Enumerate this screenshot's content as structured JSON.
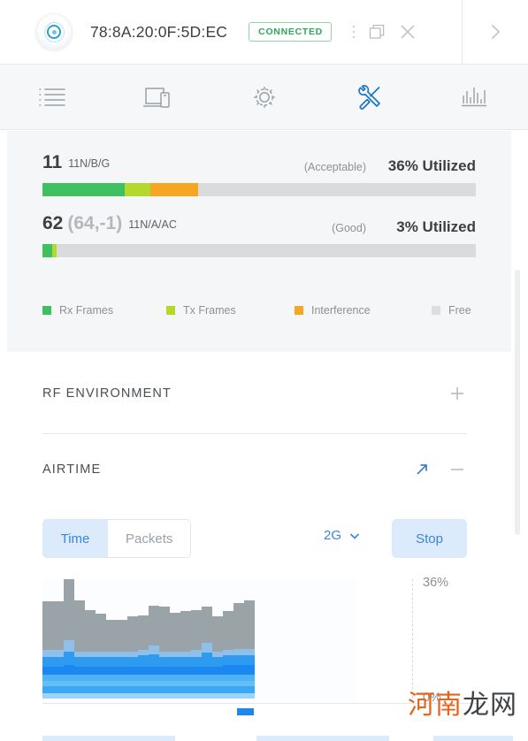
{
  "header": {
    "device_icon": "access-point-icon",
    "mac_address": "78:8A:20:0F:5D:EC",
    "status": "CONNECTED",
    "status_color": "#2fa75a",
    "actions": [
      {
        "name": "more-options",
        "icon": "kebab-menu-icon"
      },
      {
        "name": "restore-window",
        "icon": "restore-window-icon"
      },
      {
        "name": "close-panel",
        "icon": "close-icon"
      }
    ],
    "next_icon": "chevron-right-icon"
  },
  "toolbar": {
    "items": [
      {
        "name": "overview",
        "icon": "list-icon",
        "active": false
      },
      {
        "name": "devices",
        "icon": "device-screen-icon",
        "active": false
      },
      {
        "name": "config",
        "icon": "gear-icon",
        "active": false
      },
      {
        "name": "tools",
        "icon": "tools-icon",
        "active": true
      },
      {
        "name": "statistics",
        "icon": "bar-chart-icon",
        "active": false
      }
    ],
    "accent": "#1b73c8"
  },
  "utilization": {
    "rows": [
      {
        "channel": "11",
        "channel_sub": "",
        "mode": "11N/B/G",
        "quality": "(Acceptable)",
        "utilized": "36% Utilized",
        "segments": [
          {
            "name": "rx",
            "pct": 19.0,
            "color": "#3fc162"
          },
          {
            "name": "tx",
            "pct": 6.0,
            "color": "#b4d92c"
          },
          {
            "name": "interference",
            "pct": 11.0,
            "color": "#f5a623"
          }
        ],
        "free_pct": 64.0
      },
      {
        "channel": "62",
        "channel_sub": "(64,-1)",
        "mode": "11N/A/AC",
        "quality": "(Good)",
        "utilized": "3% Utilized",
        "segments": [
          {
            "name": "rx",
            "pct": 2.2,
            "color": "#3fc162"
          },
          {
            "name": "tx",
            "pct": 1.0,
            "color": "#b4d92c"
          }
        ],
        "free_pct": 96.8
      }
    ],
    "legend": [
      {
        "label": "Rx Frames",
        "color": "#3fc162"
      },
      {
        "label": "Tx Frames",
        "color": "#b4d92c"
      },
      {
        "label": "Interference",
        "color": "#f5a623"
      },
      {
        "label": "Free",
        "color": "#dcdee0"
      }
    ],
    "track_color": "#d9dbdd"
  },
  "rf_environment": {
    "title": "RF ENVIRONMENT",
    "expand_icon": "plus-icon",
    "collapsed": true
  },
  "airtime": {
    "title": "AIRTIME",
    "popout_icon": "arrow-up-right-icon",
    "collapse_icon": "minus-icon",
    "tabs": [
      {
        "label": "Time",
        "active": true
      },
      {
        "label": "Packets",
        "active": false
      }
    ],
    "band": "2G",
    "band_chevron": "chevron-down-icon",
    "action_label": "Stop"
  },
  "chart_data": {
    "type": "bar",
    "title": "Airtime",
    "xlabel": "",
    "ylabel": "",
    "ylim": [
      0,
      36
    ],
    "axis_tick_labels": [
      "36%",
      "0%"
    ],
    "grid": false,
    "legend_position": "below-right",
    "stacked": true,
    "series": [
      {
        "name": "free",
        "color": "#9aa3a8",
        "values": [
          17.5,
          17.5,
          22.0,
          18.5,
          15.0,
          13.5,
          11.5,
          11.5,
          12.5,
          12.5,
          14.5,
          16.0,
          14.0,
          14.5,
          14.5,
          13.0,
          12.5,
          14.0,
          16.5,
          17.5
        ]
      },
      {
        "name": "band-1",
        "color": "#8fc0ea",
        "values": [
          2.5,
          2.5,
          4.0,
          2.0,
          2.0,
          2.0,
          2.0,
          2.0,
          2.0,
          2.0,
          3.0,
          2.0,
          2.0,
          2.0,
          2.5,
          3.5,
          2.0,
          2.0,
          2.5,
          2.5
        ]
      },
      {
        "name": "band-2",
        "color": "#2f9bf0",
        "values": [
          3.5,
          3.5,
          5.0,
          3.5,
          3.5,
          3.5,
          3.5,
          3.5,
          3.5,
          4.0,
          4.5,
          3.5,
          3.5,
          3.5,
          3.5,
          5.0,
          3.5,
          3.5,
          3.5,
          3.5
        ]
      },
      {
        "name": "band-3",
        "color": "#1a88f0",
        "values": [
          3.0,
          3.0,
          3.5,
          3.0,
          3.0,
          3.0,
          3.0,
          3.0,
          3.0,
          3.0,
          3.0,
          3.0,
          3.0,
          3.0,
          3.0,
          3.0,
          3.0,
          3.5,
          3.5,
          3.5
        ]
      },
      {
        "name": "band-4",
        "color": "#4eb3f5",
        "values": [
          2.0,
          2.0,
          2.0,
          2.0,
          2.0,
          2.0,
          2.0,
          2.0,
          2.0,
          2.0,
          2.0,
          2.0,
          2.0,
          2.0,
          2.0,
          2.0,
          2.0,
          2.0,
          2.0,
          2.0
        ]
      },
      {
        "name": "band-5",
        "color": "#63c0f7",
        "values": [
          2.0,
          2.0,
          2.0,
          2.0,
          2.0,
          2.0,
          2.0,
          2.0,
          2.0,
          2.0,
          2.0,
          2.0,
          2.0,
          2.0,
          2.0,
          2.0,
          2.0,
          2.0,
          2.0,
          2.0
        ]
      },
      {
        "name": "band-6",
        "color": "#3aa8f2",
        "values": [
          2.5,
          2.5,
          2.5,
          2.5,
          2.5,
          2.5,
          2.5,
          2.5,
          2.5,
          2.5,
          2.5,
          2.5,
          2.5,
          2.5,
          2.5,
          2.5,
          2.5,
          2.5,
          2.5,
          2.5
        ]
      },
      {
        "name": "band-7",
        "color": "#9ed3f8",
        "values": [
          2.0,
          2.0,
          2.0,
          2.0,
          2.0,
          2.0,
          2.0,
          2.0,
          2.0,
          2.0,
          2.0,
          2.0,
          2.0,
          2.0,
          2.0,
          2.0,
          2.0,
          2.0,
          2.0,
          2.0
        ]
      }
    ],
    "legend_swatch_color": "#1a88f0"
  },
  "watermark": {
    "part_a": "河南",
    "part_b": "龙网"
  }
}
